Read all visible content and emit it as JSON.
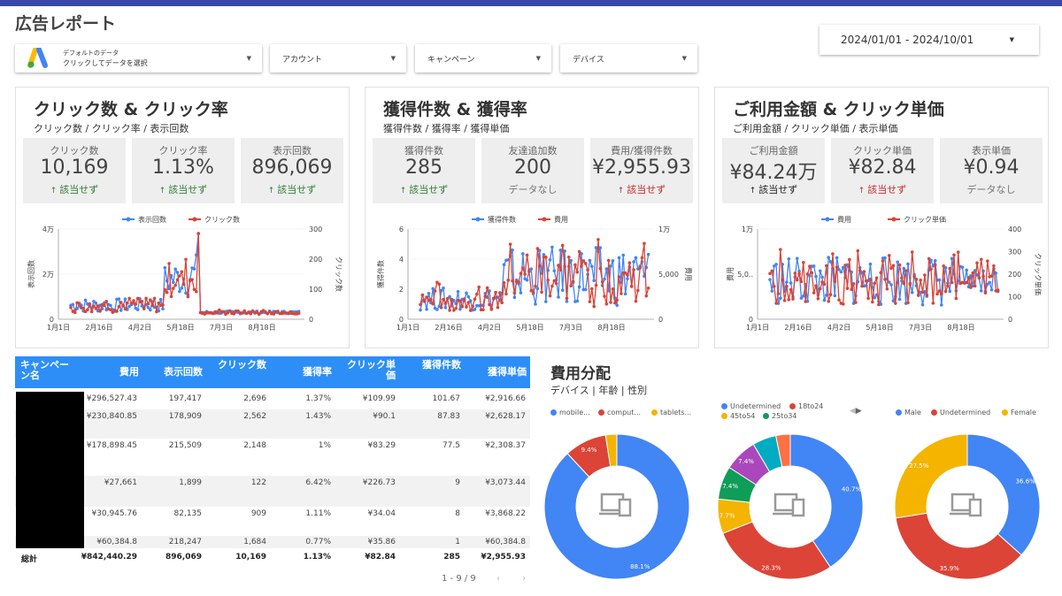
{
  "header": {
    "title": "広告レポート",
    "date_range": "2024/01/01 - 2024/10/01"
  },
  "filters": {
    "data_source_line1": "デフォルトのデータ",
    "data_source_line2": "クリックしてデータを選択",
    "account": "アカウント",
    "campaign": "キャンペーン",
    "device": "デバイス"
  },
  "panels": [
    {
      "title": "クリック数 & クリック率",
      "subtitle": "クリック数 / クリック率 / 表示回数",
      "cards": [
        {
          "label": "クリック数",
          "value": "10,169",
          "compare": "該当せず",
          "trend": "up",
          "color": "g"
        },
        {
          "label": "クリック率",
          "value": "1.13%",
          "compare": "該当せず",
          "trend": "up",
          "color": "g"
        },
        {
          "label": "表示回数",
          "value": "896,069",
          "compare": "該当せず",
          "trend": "up",
          "color": "g"
        }
      ],
      "legend": [
        "表示回数",
        "クリック数"
      ],
      "yleft_label": "表示回数",
      "yright_label": "クリック数",
      "yleft_ticks": [
        "4万",
        "2万",
        "0"
      ],
      "yright_ticks": [
        "300",
        "200",
        "100",
        "0"
      ],
      "xticks": [
        "1月1日",
        "2月16日",
        "4月2日",
        "5月18日",
        "7月3日",
        "8月18日"
      ]
    },
    {
      "title": "獲得件数 & 獲得率",
      "subtitle": "獲得件数 / 獲得率 / 獲得単価",
      "cards": [
        {
          "label": "獲得件数",
          "value": "285",
          "compare": "該当せず",
          "trend": "up",
          "color": "g"
        },
        {
          "label": "友達追加数",
          "value": "200",
          "compare": "データなし",
          "trend": "none",
          "color": "n"
        },
        {
          "label": "費用/獲得件数",
          "value": "¥2,955.93",
          "compare": "該当せず",
          "trend": "up",
          "color": "r"
        }
      ],
      "legend": [
        "獲得件数",
        "費用"
      ],
      "yleft_label": "獲得件数",
      "yright_label": "費用",
      "yleft_ticks": [
        "6",
        "4",
        "2",
        "0"
      ],
      "yright_ticks": [
        "1万",
        "5,000",
        "0"
      ],
      "xticks": [
        "1月1日",
        "2月16日",
        "4月2日",
        "5月18日",
        "7月3日",
        "8月18日"
      ]
    },
    {
      "title": "ご利用金額 & クリック単価",
      "subtitle": "ご利用金額 / クリック単価 / 表示単価",
      "cards": [
        {
          "label": "ご利用金額",
          "value": "¥84.24万",
          "compare": "該当せず",
          "trend": "up",
          "color": "k"
        },
        {
          "label": "クリック単価",
          "value": "¥82.84",
          "compare": "該当せず",
          "trend": "up",
          "color": "r"
        },
        {
          "label": "表示単価",
          "value": "¥0.94",
          "compare": "データなし",
          "trend": "none",
          "color": "n"
        }
      ],
      "legend": [
        "費用",
        "クリック単価"
      ],
      "yleft_label": "費用",
      "yright_label": "クリック単価",
      "yleft_ticks": [
        "1万",
        "5,0..",
        "0"
      ],
      "yright_ticks": [
        "400",
        "300",
        "200",
        "100",
        "0"
      ],
      "xticks": [
        "1月1日",
        "2月16日",
        "4月2日",
        "5月18日",
        "7月3日",
        "8月18日"
      ]
    }
  ],
  "table": {
    "headers": [
      "キャンペーン名",
      "費用",
      "表示回数",
      "クリック数",
      "獲得率",
      "クリック単価",
      "獲得件数",
      "獲得単価"
    ],
    "rows": [
      [
        "¥296,527.43",
        "197,417",
        "2,696",
        "1.37%",
        "¥109.99",
        "101.67",
        "¥2,916.66"
      ],
      [
        "¥230,840.85",
        "178,909",
        "2,562",
        "1.43%",
        "¥90.1",
        "87.83",
        "¥2,628.17"
      ],
      [
        "¥178,898.45",
        "215,509",
        "2,148",
        "1%",
        "¥83.29",
        "77.5",
        "¥2,308.37"
      ],
      [
        "¥27,661",
        "1,899",
        "122",
        "6.42%",
        "¥226.73",
        "9",
        "¥3,073.44"
      ],
      [
        "¥30,945.76",
        "82,135",
        "909",
        "1.11%",
        "¥34.04",
        "8",
        "¥3,868.22"
      ],
      [
        "¥60,384.8",
        "218,247",
        "1,684",
        "0.77%",
        "¥35.86",
        "1",
        "¥60,384.8"
      ]
    ],
    "total": [
      "総計",
      "¥842,440.29",
      "896,069",
      "10,169",
      "1.13%",
      "¥82.84",
      "285",
      "¥2,955.93"
    ],
    "pager": "1 - 9 / 9"
  },
  "cost_distribution": {
    "title": "費用分配",
    "subtitle": "デバイス | 年齢 | 性別"
  },
  "chart_data": [
    {
      "type": "pie",
      "title": "デバイス",
      "labels": [
        "mobile...",
        "comput...",
        "tablets..."
      ],
      "values": [
        88.1,
        9.4,
        2.5
      ],
      "colors": [
        "#4285f4",
        "#db4437",
        "#f4b400"
      ],
      "value_labels": [
        "88.1%",
        "9.4%",
        ""
      ]
    },
    {
      "type": "pie",
      "title": "年齢",
      "labels": [
        "Undetermined",
        "18to24",
        "45to54",
        "25to34"
      ],
      "values": [
        40.7,
        28.3,
        7.7,
        7.4,
        7.4,
        5.3,
        3.2
      ],
      "colors": [
        "#4285f4",
        "#db4437",
        "#f4b400",
        "#0f9d58",
        "#ab47bc",
        "#00acc1",
        "#ff7043"
      ],
      "value_labels": [
        "40.7%",
        "28.3%",
        "7.7%",
        "7.4%",
        "7.4%",
        "",
        ""
      ]
    },
    {
      "type": "pie",
      "title": "性別",
      "labels": [
        "Male",
        "Undetermined",
        "Female"
      ],
      "values": [
        36.6,
        35.9,
        27.5
      ],
      "colors": [
        "#4285f4",
        "#db4437",
        "#f4b400"
      ],
      "value_labels": [
        "36.6%",
        "35.9%",
        "27.5%"
      ]
    }
  ]
}
